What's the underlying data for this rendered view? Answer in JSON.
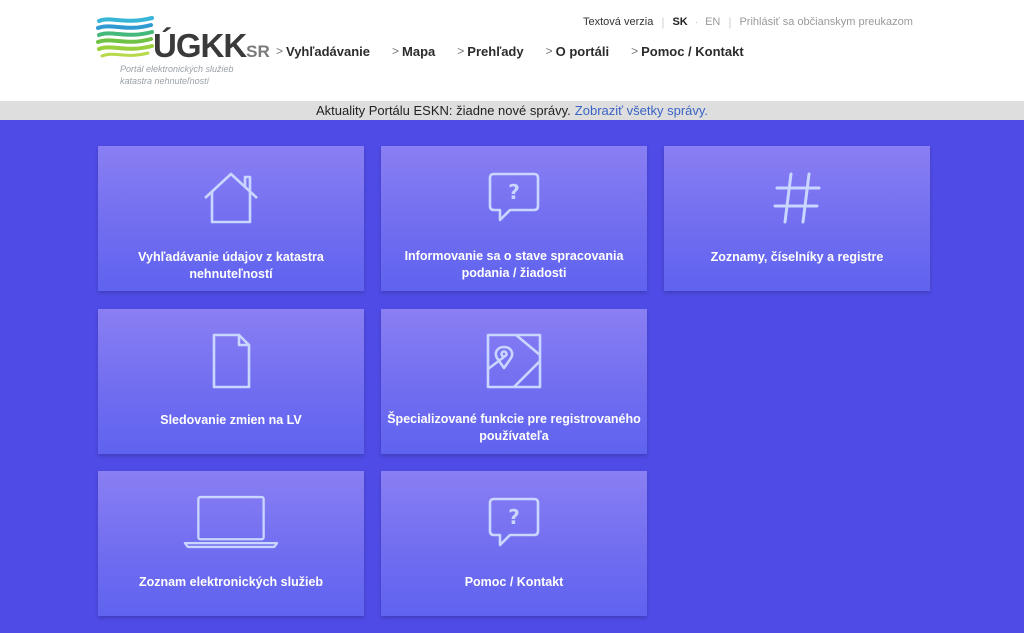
{
  "header": {
    "logo_text": "ÚGKK",
    "logo_suffix": "SR",
    "logo_subtitle_line1": "Portál elektronických služieb",
    "logo_subtitle_line2": "katastra nehnuteľností",
    "text_version": "Textová verzia",
    "lang_sk": "SK",
    "lang_en": "EN",
    "login": "Prihlásiť sa občianskym preukazom"
  },
  "nav": {
    "items": [
      "Vyhľadávanie",
      "Mapa",
      "Prehľady",
      "O portáli",
      "Pomoc / Kontakt"
    ]
  },
  "news": {
    "text": "Aktuality Portálu ESKN: žiadne nové správy.",
    "link": "Zobraziť všetky správy."
  },
  "tiles": [
    {
      "label": "Vyhľadávanie údajov z katastra nehnuteľností",
      "icon": "house-icon"
    },
    {
      "label": "Informovanie sa o stave spracovania podania / žiadosti",
      "icon": "question-bubble-icon"
    },
    {
      "label": "Zoznamy, číselníky a registre",
      "icon": "hash-icon"
    },
    {
      "label": "Sledovanie zmien na LV",
      "icon": "document-icon"
    },
    {
      "label": "Špecializované funkcie pre registrovaného používateľa",
      "icon": "map-pin-icon"
    },
    {
      "label": "Zoznam elektronických služieb",
      "icon": "laptop-icon"
    },
    {
      "label": "Pomoc / Kontakt",
      "icon": "question-bubble-icon"
    }
  ],
  "colors": {
    "background": "#4f4be6",
    "tile_top": "#8a7ff3",
    "tile_bottom": "#5f63ef",
    "link": "#3a63c6"
  }
}
